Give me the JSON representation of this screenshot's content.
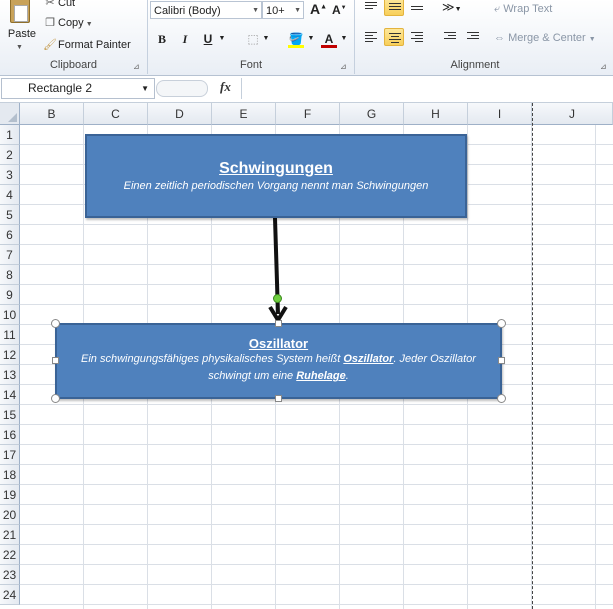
{
  "ribbon": {
    "clipboard": {
      "paste_label": "Paste",
      "cut_label": "Cut",
      "copy_label": "Copy",
      "format_painter_label": "Format Painter",
      "group_label": "Clipboard"
    },
    "font": {
      "family": "Calibri (Body)",
      "size": "10",
      "bold": "B",
      "italic": "I",
      "underline": "U",
      "group_label": "Font",
      "highlight_color": "#ffff00",
      "font_color": "#c00000"
    },
    "alignment": {
      "wrap_text_label": "Wrap Text",
      "merge_center_label": "Merge & Center",
      "group_label": "Alignment"
    }
  },
  "formula_bar": {
    "name_box": "Rectangle 2",
    "fx": "fx",
    "formula": ""
  },
  "sheet": {
    "columns": [
      "B",
      "C",
      "D",
      "E",
      "F",
      "G",
      "H",
      "I",
      "J"
    ],
    "rows": [
      "1",
      "2",
      "3",
      "4",
      "5",
      "6",
      "7",
      "8",
      "9",
      "10",
      "11",
      "12",
      "13",
      "14",
      "15",
      "16",
      "17",
      "18",
      "19",
      "20",
      "21",
      "22",
      "23",
      "24"
    ]
  },
  "shapes": {
    "top_box": {
      "title": "Schwingungen",
      "text": "Einen zeitlich periodischen Vorgang nennt man Schwingungen"
    },
    "bottom_box": {
      "title": "Oszillator",
      "text_part1": "Ein schwingungsfähiges physikalisches System heißt ",
      "keyword1": "Oszillator",
      "text_part2": ". Jeder Oszillator schwingt um eine ",
      "keyword2": "Ruhelage",
      "text_part3": "."
    }
  },
  "colors": {
    "shape_fill": "#4f81bd",
    "shape_border": "#3a6396",
    "selected_align": "#f8cf5a"
  }
}
